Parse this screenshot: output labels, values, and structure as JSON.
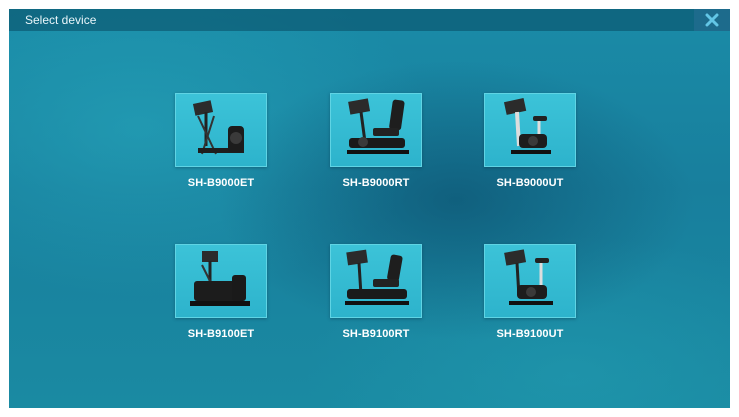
{
  "window": {
    "title": "Select device",
    "close_icon": "close-icon"
  },
  "devices": [
    {
      "label": "SH-B9000ET",
      "icon": "elliptical-trainer-icon"
    },
    {
      "label": "SH-B9000RT",
      "icon": "recumbent-bike-icon"
    },
    {
      "label": "SH-B9000UT",
      "icon": "upright-bike-icon"
    },
    {
      "label": "SH-B9100ET",
      "icon": "elliptical-trainer-icon"
    },
    {
      "label": "SH-B9100RT",
      "icon": "recumbent-bike-icon"
    },
    {
      "label": "SH-B9100UT",
      "icon": "upright-bike-icon"
    }
  ],
  "colors": {
    "background": "#1a8ba7",
    "tile": "#35bcd2",
    "titlebar": "#0a4a62",
    "close_button": "#1d6b8c",
    "text": "#ffffff"
  }
}
